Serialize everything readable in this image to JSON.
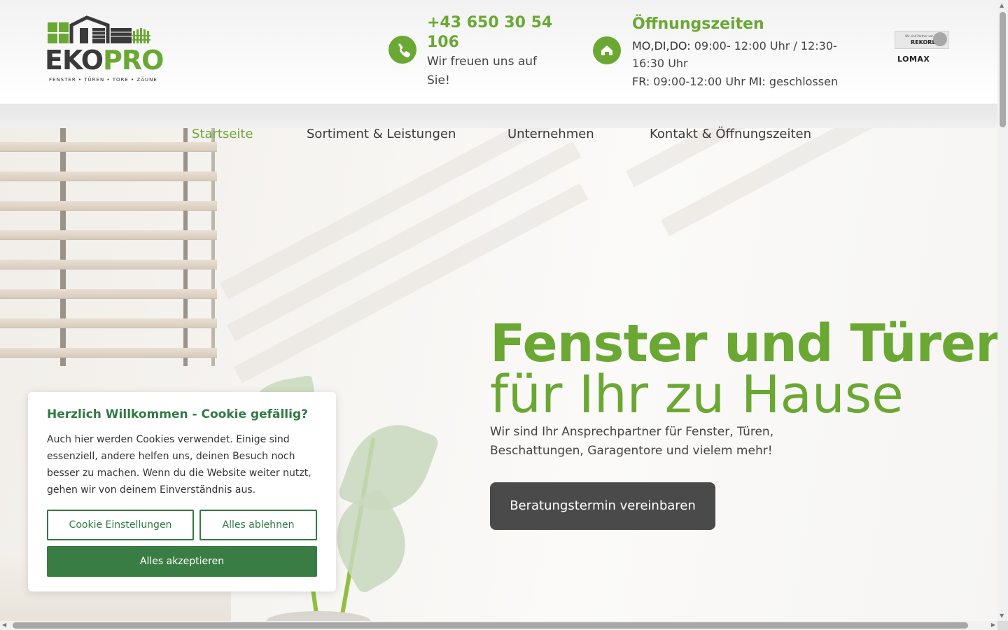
{
  "header": {
    "logo": {
      "brand_eko": "EKO",
      "brand_pro": "PRO",
      "tagline": "FENSTER • TÜREN • TORE • ZÄUNE"
    },
    "phone": {
      "number": "+43 650 30 54 106",
      "subtitle": "Wir freuen uns auf Sie!",
      "icon": "phone-icon"
    },
    "hours": {
      "title": "Öffnungszeiten",
      "line1_label": "MO,DI,DO:",
      "line1_value": " 09:00- 12:00 Uhr / 12:30-16:30 Uhr",
      "line2_label1": "FR:",
      "line2_value1": " 09:00-12:00 Uhr ",
      "line2_label2": "MI:",
      "line2_value2": " geschlossen",
      "icon": "home-icon"
    },
    "partners": {
      "rekord_small": "Wir sind Partner von",
      "rekord_name": "REKORD",
      "lomax_name": "LOMAX"
    }
  },
  "nav": {
    "items": [
      {
        "label": "Startseite",
        "active": true
      },
      {
        "label": "Sortiment & Leistungen",
        "active": false
      },
      {
        "label": "Unternehmen",
        "active": false
      },
      {
        "label": "Kontakt & Öffnungszeiten",
        "active": false
      }
    ]
  },
  "hero": {
    "title": "Fenster und Türen",
    "subtitle": "für Ihr zu Hause",
    "description": "Wir sind Ihr Ansprechpartner für Fenster, Türen, Beschattungen, Garagentore und vielem mehr!",
    "cta_label": "Beratungstermin vereinbaren"
  },
  "cookie": {
    "title": "Herzlich Willkommen - Cookie gefällig?",
    "text": "Auch hier werden Cookies verwendet. Einige sind essenziell, andere helfen uns, deinen Besuch noch besser zu machen. Wenn du die Website weiter nutzt, gehen wir von deinem Einverständnis aus.",
    "settings_label": "Cookie Einstellungen",
    "reject_label": "Alles ablehnen",
    "accept_label": "Alles akzeptieren"
  },
  "colors": {
    "brand_green": "#6aa833",
    "cookie_green": "#3a7d44",
    "cta_dark": "#4a4a4a"
  }
}
